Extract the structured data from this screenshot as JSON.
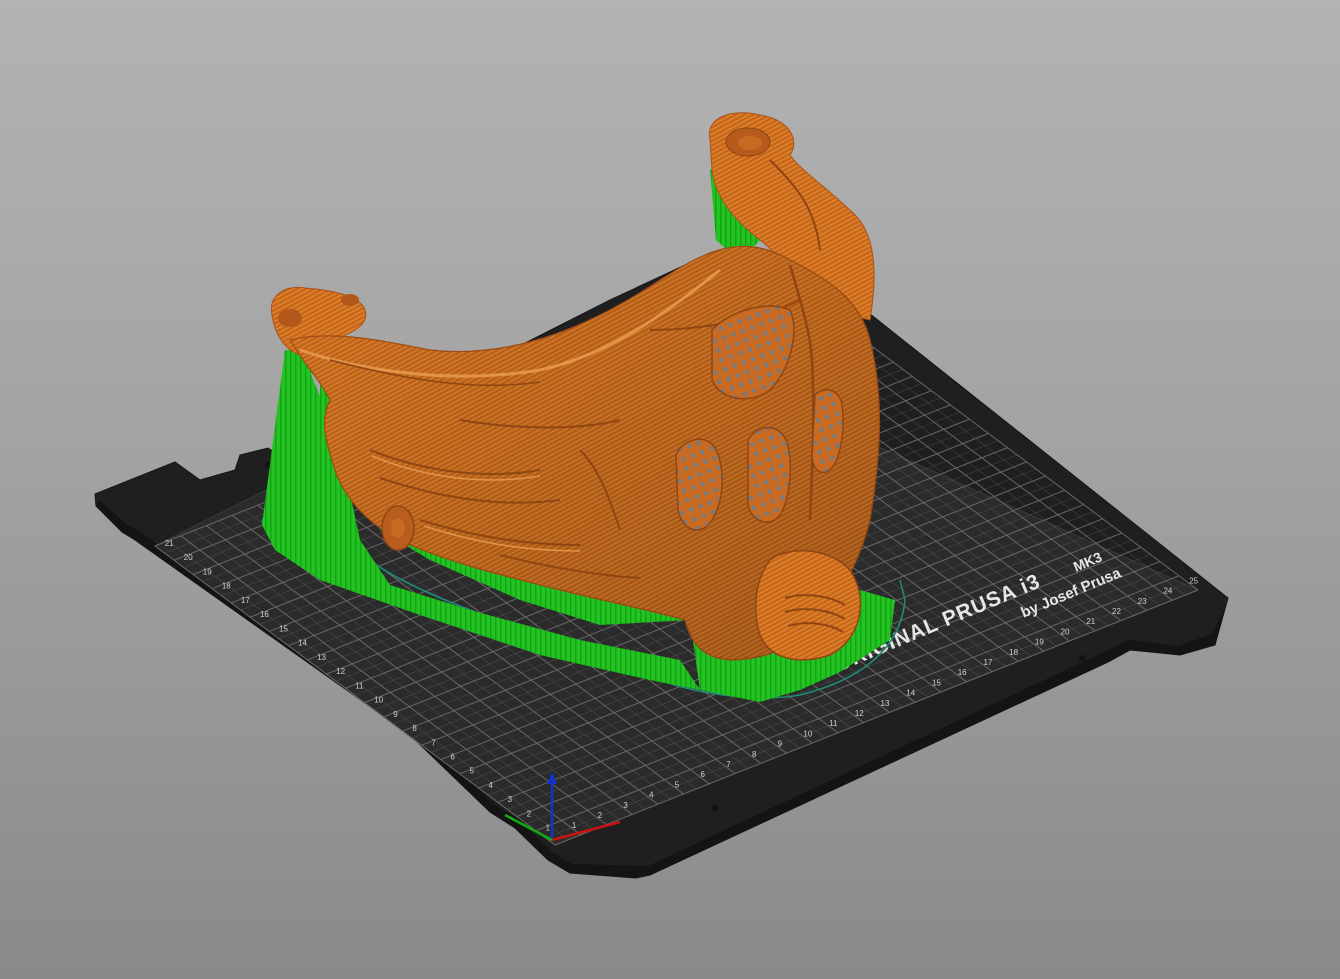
{
  "viewport": {
    "view_mode": "sliced-preview-3d"
  },
  "printer_bed": {
    "brand_line": "ORIGINAL PRUSA i3",
    "model": "MK3",
    "byline": "by Josef Prusa",
    "x_ticks": [
      "1",
      "2",
      "3",
      "4",
      "5",
      "6",
      "7",
      "8",
      "9",
      "10",
      "11",
      "12",
      "13",
      "14",
      "15",
      "16",
      "17",
      "18",
      "19",
      "20",
      "21",
      "22",
      "23",
      "24",
      "25"
    ],
    "y_ticks": [
      "1",
      "2",
      "3",
      "4",
      "5",
      "6",
      "7",
      "8",
      "9",
      "10",
      "11",
      "12",
      "13",
      "14",
      "15",
      "16",
      "17",
      "18",
      "19",
      "20",
      "21"
    ],
    "colors": {
      "sheet": "#2b2b2b",
      "frame": "#1e1e1e",
      "grid": "#6e6e6e",
      "text": "#e6e6e6"
    }
  },
  "model": {
    "name": "mask",
    "feature_colors": {
      "perimeter": "#d2691e",
      "support": "#22cc22",
      "skirt": "#1f8a7a"
    }
  },
  "axes": {
    "x_color": "#cc1111",
    "y_color": "#11aa11",
    "z_color": "#1133cc"
  }
}
